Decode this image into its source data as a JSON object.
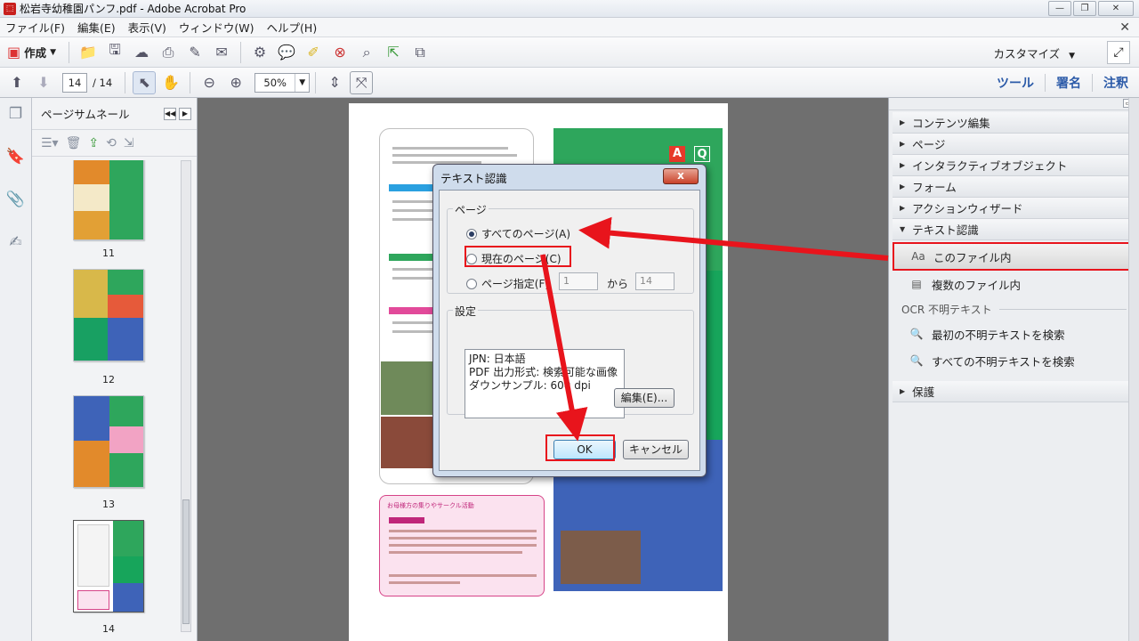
{
  "window": {
    "title": "松岩寺幼稚園パンフ.pdf - Adobe Acrobat Pro",
    "controls": [
      "—",
      "❐",
      "✕"
    ]
  },
  "menu": [
    "ファイル(F)",
    "編集(E)",
    "表示(V)",
    "ウィンドウ(W)",
    "ヘルプ(H)"
  ],
  "toolbar": {
    "create_label": "作成",
    "customize_label": "カスタマイズ",
    "page_current": "14",
    "page_total": "/ 14",
    "zoom": "50%",
    "right_links": [
      "ツール",
      "署名",
      "注釈"
    ]
  },
  "thumb_panel": {
    "title": "ページサムネール",
    "pages": [
      "11",
      "12",
      "13",
      "14"
    ]
  },
  "document": {
    "badge_a": "A",
    "badge_q": "Q",
    "pink_title": "お母様方の集りやサークル活動"
  },
  "right_panel": {
    "sections_top": [
      "コンテンツ編集",
      "ページ",
      "インタラクティブオブジェクト",
      "フォーム",
      "アクションウィザード",
      "テキスト認識"
    ],
    "ocr_items": [
      "このファイル内",
      "複数のファイル内"
    ],
    "ocr_suspect_label": "OCR 不明テキスト",
    "suspect_items": [
      "最初の不明テキストを検索",
      "すべての不明テキストを検索"
    ],
    "section_bottom": "保護"
  },
  "dialog": {
    "title": "テキスト認識",
    "close_label": "x",
    "group_pages": "ページ",
    "radio_all": "すべてのページ(A)",
    "radio_current": "現在のページ(C)",
    "radio_range": "ページ指定(F)",
    "range_from": "1",
    "range_to_label": "から",
    "range_to": "14",
    "group_settings": "設定",
    "settings_lines": [
      "JPN: 日本語",
      "PDF 出力形式: 検索可能な画像",
      "ダウンサンプル: 600 dpi"
    ],
    "edit_button": "編集(E)...",
    "ok_button": "OK",
    "cancel_button": "キャンセル"
  },
  "colors": {
    "highlight": "#e8141c",
    "arrow": "#e8141c"
  }
}
